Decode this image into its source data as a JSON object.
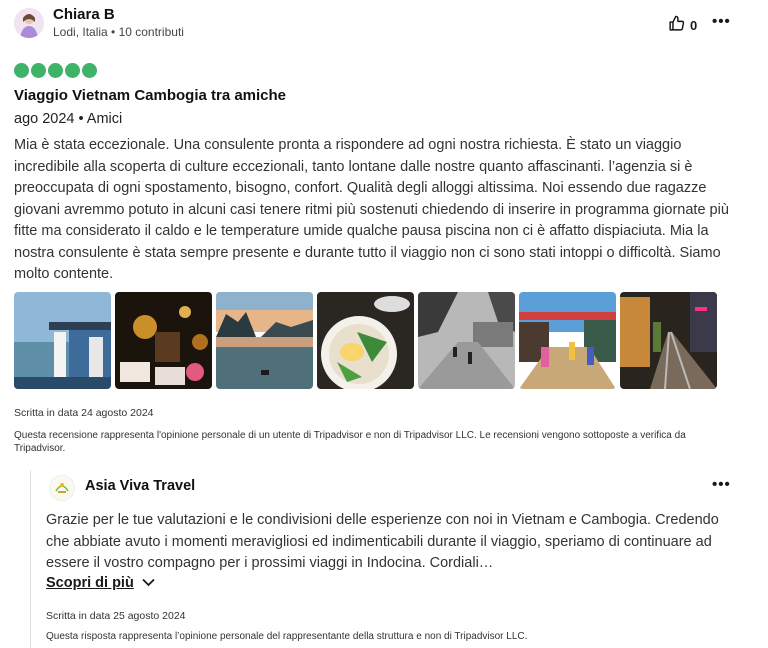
{
  "review": {
    "user_name": "Chiara B",
    "user_meta": "Lodi, Italia • 10 contributi",
    "like_count": "0",
    "more_glyph": "•••",
    "rating_value": 5,
    "rating_max": 5,
    "title": "Viaggio Vietnam Cambogia tra amiche",
    "trip_info": "ago 2024 • Amici",
    "body": "Mia è stata eccezionale. Una consulente pronta a rispondere ad ogni nostra richiesta. È stato un viaggio incredibile alla scoperta di culture eccezionali, tanto lontane dalle nostre quanto affascinanti. l’agenzia si è preoccupata di ogni spostamento, bisogno, confort. Qualità degli alloggi altissima. Noi essendo due ragazze giovani avremmo potuto in alcuni casi tenere ritmi più sostenuti chiedendo di inserire in programma giornate più fitte ma considerato il caldo e le temperature umide qualche pausa piscina non ci è affatto dispiaciuta. Mia la nostra consulente è stata sempre presente e durante tutto il viaggio non ci sono stati intoppi o difficoltà. Siamo molto contente.",
    "photos": [
      {
        "name": "photo-boat-river"
      },
      {
        "name": "photo-lanterns-night"
      },
      {
        "name": "photo-bay-sunset"
      },
      {
        "name": "photo-food-bowl"
      },
      {
        "name": "photo-village-bw"
      },
      {
        "name": "photo-colorful-street"
      },
      {
        "name": "photo-train-street"
      }
    ],
    "date": "Scritta in data 24 agosto 2024",
    "disclaimer": "Questa recensione rappresenta l'opinione personale di un utente di Tripadvisor e non di Tripadvisor LLC. Le recensioni vengono sottoposte a verifica da Tripadvisor."
  },
  "reply": {
    "author": "Asia Viva Travel",
    "more_glyph": "•••",
    "text": "Grazie per le tue valutazioni e le condivisioni delle esperienze con noi in Vietnam e Cambogia. Credendo che abbiate avuto i momenti meravigliosi ed indimenticabili durante il viaggio, speriamo di continuare ad essere il vostro compagno per i prossimi viaggi in Indocina. Cordiali…",
    "read_more": "Scopri di più",
    "date": "Scritta in data 25 agosto 2024",
    "disclaimer": "Questa risposta rappresenta l’opinione personale del rappresentante della struttura e non di Tripadvisor LLC."
  },
  "colors": {
    "rating_green": "#3fb36a"
  }
}
